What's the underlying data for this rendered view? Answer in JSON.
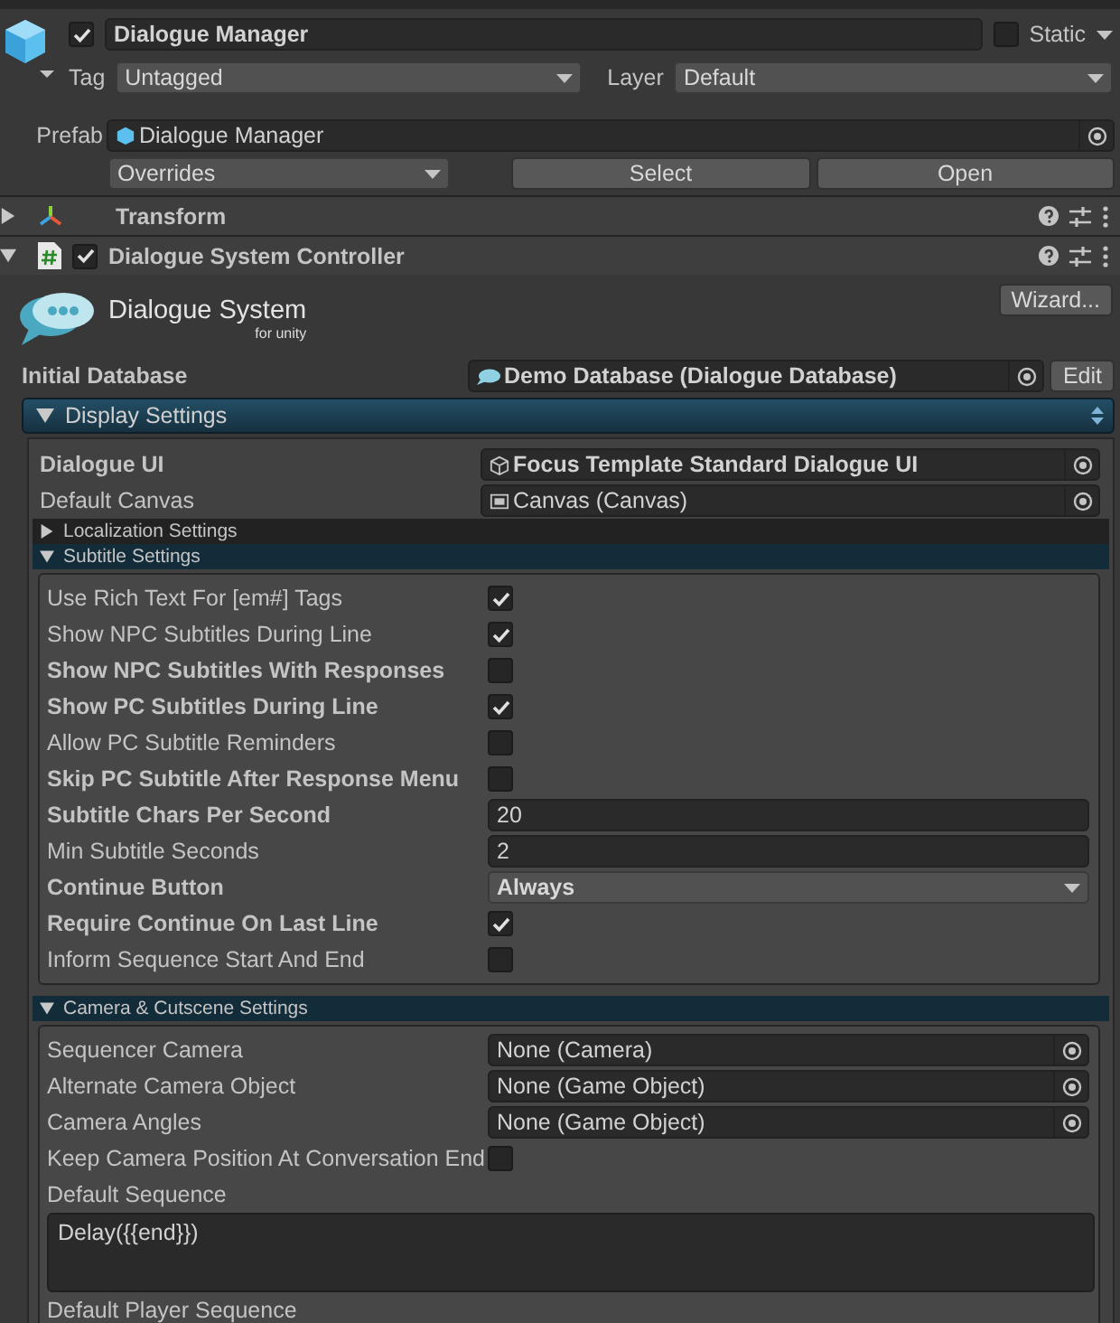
{
  "game_object": {
    "active": true,
    "name": "Dialogue Manager",
    "static_label": "Static",
    "static": false,
    "tag_label": "Tag",
    "tag": "Untagged",
    "layer_label": "Layer",
    "layer": "Default"
  },
  "prefab": {
    "label": "Prefab",
    "value": "Dialogue Manager",
    "overrides": "Overrides",
    "buttons": [
      "Select",
      "Open"
    ]
  },
  "components": [
    {
      "kind": "transform",
      "name": "Transform",
      "expanded": false
    },
    {
      "kind": "script",
      "name": "Dialogue System Controller",
      "expanded": true,
      "enabled": true
    }
  ],
  "logo": {
    "title": "Dialogue System",
    "subtitle": "for unity"
  },
  "wizard_button": "Wizard...",
  "initial_database": {
    "label": "Initial Database",
    "value": "Demo Database (Dialogue Database)",
    "button": "Edit"
  },
  "display_settings": {
    "title": "Display Settings",
    "expanded": true,
    "fields": [
      {
        "kind": "object",
        "label": "Dialogue UI",
        "bold": true,
        "value": "Focus Template Standard Dialogue UI"
      },
      {
        "kind": "object",
        "label": "Default Canvas",
        "bold": false,
        "value": "Canvas (Canvas)"
      }
    ],
    "sections": [
      {
        "title": "Localization Settings",
        "expanded": false
      },
      {
        "title": "Subtitle Settings",
        "expanded": true,
        "fields": [
          {
            "kind": "checkbox",
            "label": "Use Rich Text For [em#] Tags",
            "bold": false,
            "checked": true
          },
          {
            "kind": "checkbox",
            "label": "Show NPC Subtitles During Line",
            "bold": false,
            "checked": true
          },
          {
            "kind": "checkbox",
            "label": "Show NPC Subtitles With Responses",
            "bold": true,
            "checked": false
          },
          {
            "kind": "checkbox",
            "label": "Show PC Subtitles During Line",
            "bold": true,
            "checked": true
          },
          {
            "kind": "checkbox",
            "label": "Allow PC Subtitle Reminders",
            "bold": false,
            "checked": false
          },
          {
            "kind": "checkbox",
            "label": "Skip PC Subtitle After Response Menu",
            "bold": true,
            "checked": false
          },
          {
            "kind": "text",
            "label": "Subtitle Chars Per Second",
            "bold": true,
            "value": "20"
          },
          {
            "kind": "text",
            "label": "Min Subtitle Seconds",
            "bold": false,
            "value": "2"
          },
          {
            "kind": "dropdown",
            "label": "Continue Button",
            "bold": true,
            "value": "Always"
          },
          {
            "kind": "checkbox",
            "label": "Require Continue On Last Line",
            "bold": true,
            "checked": true
          },
          {
            "kind": "checkbox",
            "label": "Inform Sequence Start And End",
            "bold": false,
            "checked": false
          }
        ]
      },
      {
        "title": "Camera & Cutscene Settings",
        "expanded": true,
        "fields": [
          {
            "kind": "object",
            "label": "Sequencer Camera",
            "bold": false,
            "value": "None (Camera)"
          },
          {
            "kind": "object",
            "label": "Alternate Camera Object",
            "bold": false,
            "value": "None (Game Object)"
          },
          {
            "kind": "object",
            "label": "Camera Angles",
            "bold": false,
            "value": "None (Game Object)"
          },
          {
            "kind": "checkbox",
            "label": "Keep Camera Position At Conversation End",
            "bold": false,
            "checked": false
          },
          {
            "kind": "textarea",
            "label": "Default Sequence",
            "bold": false,
            "value": "Delay({{end}})"
          },
          {
            "kind": "label",
            "label": "Default Player Sequence",
            "bold": false
          }
        ]
      }
    ]
  }
}
